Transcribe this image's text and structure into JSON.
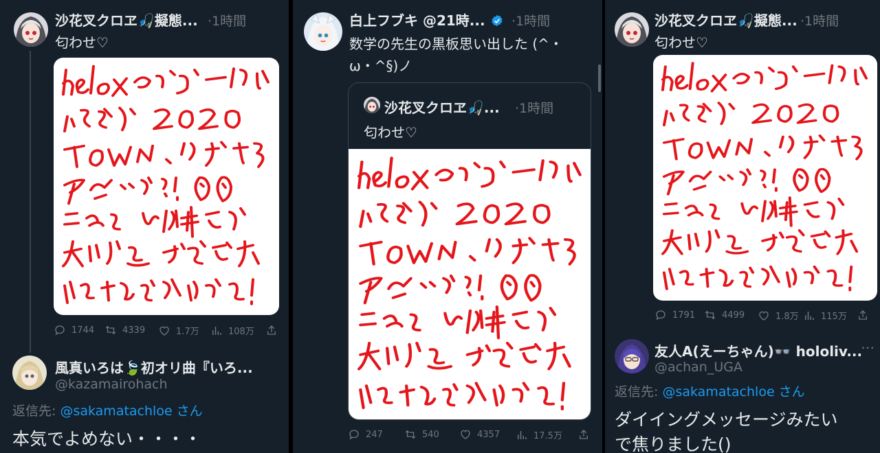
{
  "left": {
    "tweet": {
      "name": "沙花叉クロヱ🎣擬態...",
      "time": "·1時間",
      "text": "匂わせ♡",
      "stats": {
        "replies": "1744",
        "retweets": "4339",
        "likes": "1.7万",
        "views": "108万"
      }
    },
    "reply": {
      "name": "風真いろは🍃初オリ曲『いろ...",
      "handle": "@kazamairohach",
      "reply_prefix": "返信先: ",
      "reply_to": "@sakamatachloe",
      "reply_suffix": " さん",
      "text": "本気でよめない・・・・"
    }
  },
  "middle": {
    "tweet": {
      "name": "白上フブキ @21時...",
      "time": "·1時間",
      "text_line1": "数学の先生の黒板思い出した (^・",
      "text_line2": "ω・^§)ノ",
      "stats": {
        "replies": "247",
        "retweets": "540",
        "likes": "4357",
        "views": "17.5万"
      }
    },
    "quote": {
      "name": "沙花叉クロヱ🎣...",
      "time": "·1時間",
      "text": "匂わせ♡"
    }
  },
  "right": {
    "tweet": {
      "name": "沙花叉クロヱ🎣擬態...",
      "time": "·1時間",
      "text": "匂わせ♡",
      "stats": {
        "replies": "1791",
        "retweets": "4499",
        "likes": "1.8万",
        "views": "115万"
      }
    },
    "reply": {
      "name": "友人A(えーちゃん)👓 hololiv...",
      "handle": "@achan_UGA",
      "reply_prefix": "返信先: ",
      "reply_to": "@sakamatachloe",
      "reply_suffix": " さん",
      "text_line1": "ダイイングメッセージみたい",
      "text_line2": "で焦りました()"
    }
  },
  "colors": {
    "background": "#15202b",
    "text": "#e7e9ea",
    "muted": "#71767b",
    "accent": "#1d9bf0",
    "scribble": "#e4161b"
  }
}
